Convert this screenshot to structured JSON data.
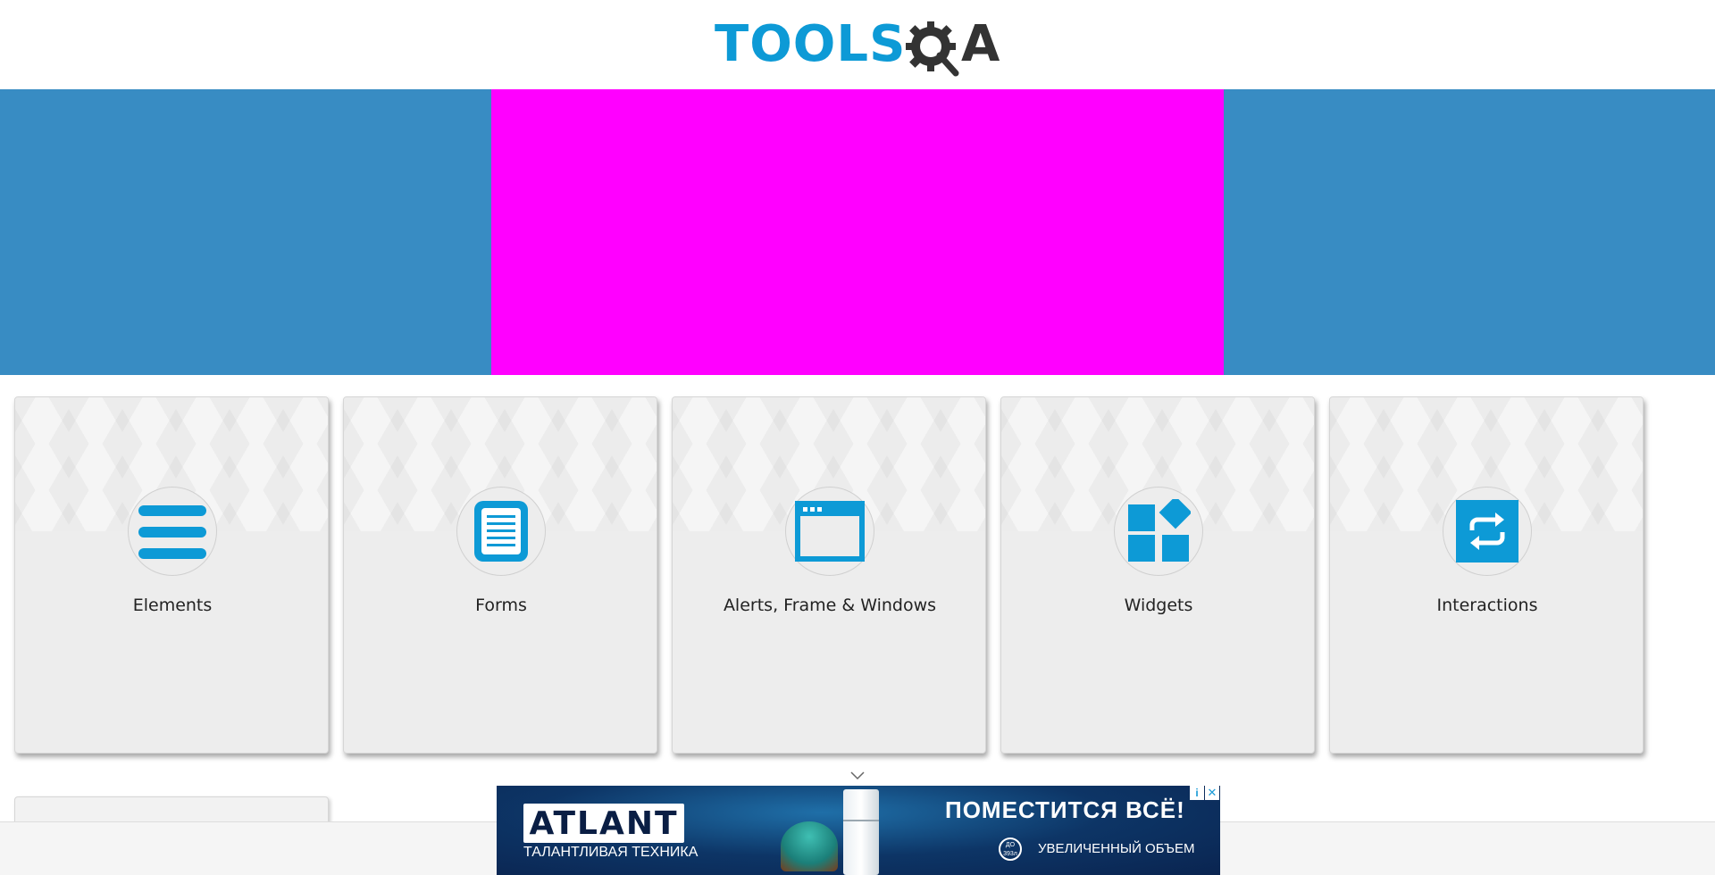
{
  "header": {
    "logo_tools": "TOOLS",
    "logo_a": "A"
  },
  "colors": {
    "brand_blue": "#0d9ad6",
    "banner_side": "#388cc3",
    "banner_center": "#ff00ff"
  },
  "cards": [
    {
      "title": "Elements",
      "icon": "list-icon"
    },
    {
      "title": "Forms",
      "icon": "document-icon"
    },
    {
      "title": "Alerts, Frame & Windows",
      "icon": "browser-window-icon"
    },
    {
      "title": "Widgets",
      "icon": "widgets-icon"
    },
    {
      "title": "Interactions",
      "icon": "repeat-icon"
    }
  ],
  "ad": {
    "brand": "ATLANT",
    "brand_sub": "ТАЛАНТЛИВАЯ ТЕХНИКА",
    "headline": "ПОМЕСТИТСЯ ВСЁ!",
    "badge": "ДО 393л",
    "sub": "УВЕЛИЧЕННЫЙ ОБЪЕМ",
    "info_glyph": "i",
    "close_glyph": "✕"
  }
}
